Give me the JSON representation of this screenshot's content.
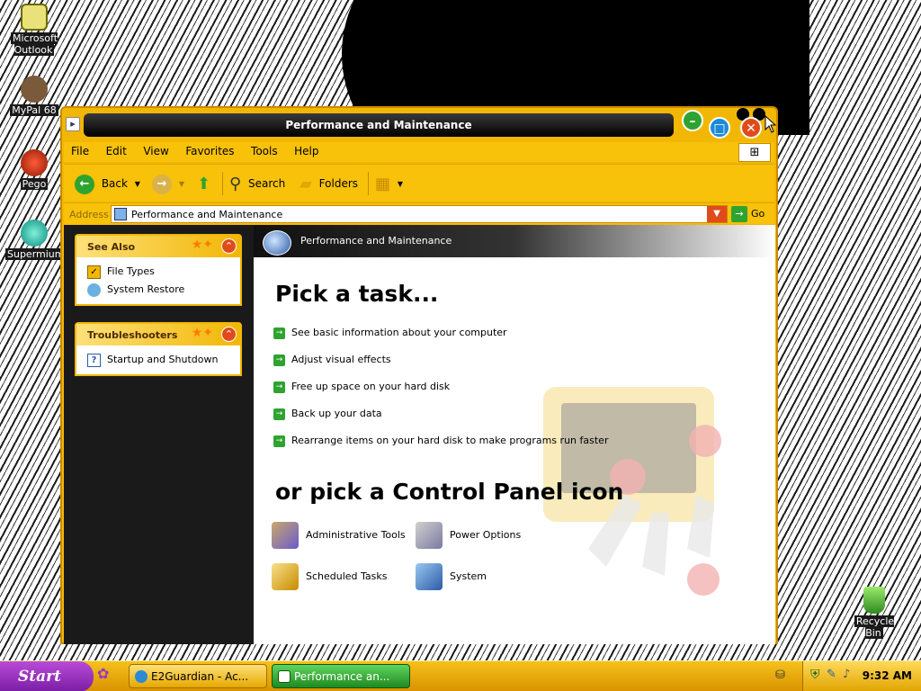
{
  "desktop": {
    "icons": [
      {
        "label": "Microsoft Outlook"
      },
      {
        "label": "MyPal 68"
      },
      {
        "label": "Pego"
      },
      {
        "label": "Supermium"
      },
      {
        "label": "Recycle Bin"
      }
    ]
  },
  "window": {
    "title": "Performance and Maintenance",
    "menu": [
      "File",
      "Edit",
      "View",
      "Favorites",
      "Tools",
      "Help"
    ],
    "toolbar": {
      "back_label": "Back",
      "search_label": "Search",
      "folders_label": "Folders"
    },
    "address": {
      "label": "Address",
      "value": "Performance and Maintenance",
      "go_label": "Go"
    },
    "see_also": {
      "title": "See Also",
      "items": [
        {
          "label": "File Types",
          "icon": "file-types-icon"
        },
        {
          "label": "System Restore",
          "icon": "system-restore-icon"
        }
      ]
    },
    "troubleshooters": {
      "title": "Troubleshooters",
      "items": [
        {
          "label": "Startup and Shutdown",
          "icon": "help-icon"
        }
      ]
    },
    "content": {
      "header": "Performance and Maintenance",
      "pick_task": "Pick a task...",
      "tasks": [
        "See basic information about your computer",
        "Adjust visual effects",
        "Free up space on your hard disk",
        "Back up your data",
        "Rearrange items on your hard disk to make programs run faster"
      ],
      "pick_icon": "or pick a Control Panel icon",
      "cp_icons": [
        {
          "label": "Administrative Tools",
          "icon": "administrative-tools-icon"
        },
        {
          "label": "Power Options",
          "icon": "power-options-icon"
        },
        {
          "label": "Scheduled Tasks",
          "icon": "scheduled-tasks-icon"
        },
        {
          "label": "System",
          "icon": "system-icon"
        }
      ]
    }
  },
  "taskbar": {
    "start_label": "Start",
    "buttons": [
      {
        "label": "E2Guardian - Ac..."
      },
      {
        "label": "Performance an..."
      }
    ],
    "clock": "9:32 AM"
  },
  "colors": {
    "accent": "#f2b705",
    "taskbar": "#e0a400",
    "start": "#9b35c5",
    "active_task": "#2fa32f"
  }
}
